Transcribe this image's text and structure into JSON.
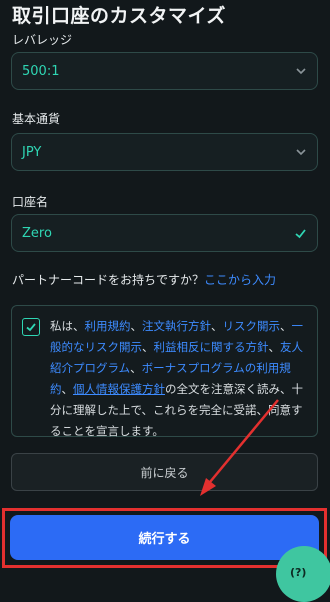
{
  "page": {
    "title": "取引口座のカスタマイズ"
  },
  "leverage": {
    "label": "レバレッジ",
    "value": "500:1",
    "icon": "chevron-down-icon"
  },
  "currency": {
    "label": "基本通貨",
    "value": "JPY",
    "icon": "chevron-down-icon"
  },
  "account_name": {
    "label": "口座名",
    "value": "Zero",
    "icon": "check-icon"
  },
  "partner": {
    "question": "パートナーコードをお持ちですか？",
    "link": "ここから入力"
  },
  "terms": {
    "checked": true,
    "t0": "私は、",
    "l1": "利用規約",
    "s1": "、",
    "l2": "注文執行方針",
    "s2": "、",
    "l3": "リスク開示",
    "s3": "、",
    "l4": "一般的なリスク開示",
    "s4": "、",
    "l5": "利益相反に関する方針",
    "s5": "、",
    "l6": "友人紹介プログラム",
    "s6": "、",
    "l7": "ボーナスプログラムの利用規約",
    "s7": "、",
    "l8": "個人情報保護方針",
    "t9": "の全文を注意深く読み、十分に理解した上で、これらを完全に受諾、同意することを宣言します。"
  },
  "buttons": {
    "back": "前に戻る",
    "continue": "続行する"
  },
  "help": {
    "label": "(?)"
  },
  "colors": {
    "accent": "#2fd6b4",
    "link": "#3d8bff",
    "primary": "#2c6bf5",
    "annotation": "#e3302f"
  }
}
